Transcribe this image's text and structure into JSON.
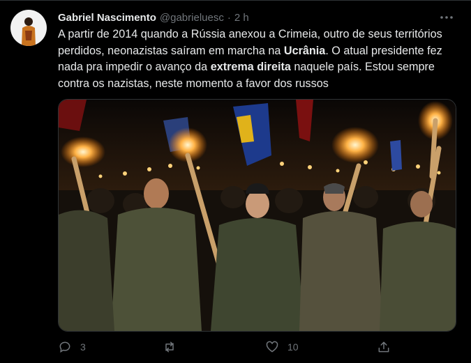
{
  "tweet": {
    "name": "Gabriel Nascimento",
    "handle": "@gabrieluesc",
    "separator": "·",
    "time": "2 h",
    "text": {
      "part1": "A partir de 2014 quando a Rússia anexou a Crimeia, outro de seus territórios perdidos, neonazistas saíram em marcha na ",
      "bold1": "Ucrânia",
      "part2": ". O atual presidente fez nada pra impedir o avanço da ",
      "bold2": "extrema direita",
      "part3": " naquele país. Estou sempre contra os nazistas, neste momento a favor dos russos"
    },
    "media_icon": "photo-torch-march",
    "actions": {
      "reply_count": "3",
      "retweet_count": "",
      "like_count": "10"
    }
  },
  "colors": {
    "background": "#000000",
    "text": "#e7e9ea",
    "secondary": "#71767b",
    "border": "#2f3336"
  }
}
